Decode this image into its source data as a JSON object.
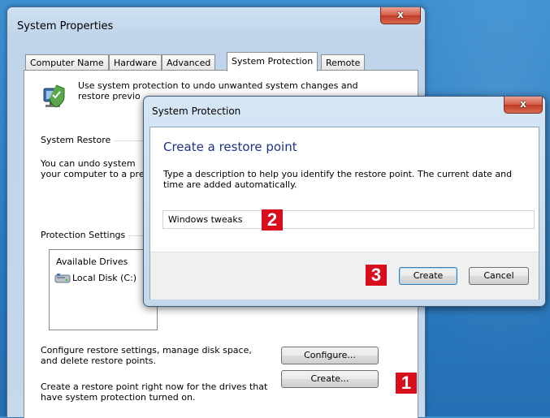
{
  "main_window": {
    "title": "System Properties",
    "close_glyph": "x",
    "tabs": [
      {
        "label": "Computer Name",
        "active": false
      },
      {
        "label": "Hardware",
        "active": false
      },
      {
        "label": "Advanced",
        "active": false
      },
      {
        "label": "System Protection",
        "active": true
      },
      {
        "label": "Remote",
        "active": false
      }
    ],
    "intro_line1": "Use system protection to undo unwanted system changes and",
    "intro_line2": "restore previo",
    "system_restore": {
      "label": "System Restore",
      "text_line1": "You can undo system",
      "text_line2": "your computer to a pre"
    },
    "protection_settings": {
      "label": "Protection Settings",
      "available_drives_header": "Available Drives",
      "drive_label": "Local Disk (C:)"
    },
    "configure": {
      "text_line1": "Configure restore settings, manage disk space,",
      "text_line2": "and delete restore points.",
      "button": "Configure..."
    },
    "create": {
      "text_line1": "Create a restore point right now for the drives that",
      "text_line2": "have system protection turned on.",
      "button": "Create..."
    }
  },
  "dialog": {
    "title": "System Protection",
    "close_glyph": "x",
    "heading": "Create a restore point",
    "description_line1": "Type a description to help you identify the restore point. The current date and",
    "description_line2": "time are added automatically.",
    "input_value": "Windows tweaks",
    "create_button": "Create",
    "cancel_button": "Cancel"
  },
  "markers": {
    "m1": "1",
    "m2": "2",
    "m3": "3"
  },
  "colors": {
    "marker_red": "#d80e1c",
    "heading_blue": "#1e3287",
    "desktop_blue": "#2e7fc4"
  },
  "icons": {
    "shield": "system-protection-shield-icon",
    "drive": "hard-drive-icon",
    "close": "close-icon"
  }
}
